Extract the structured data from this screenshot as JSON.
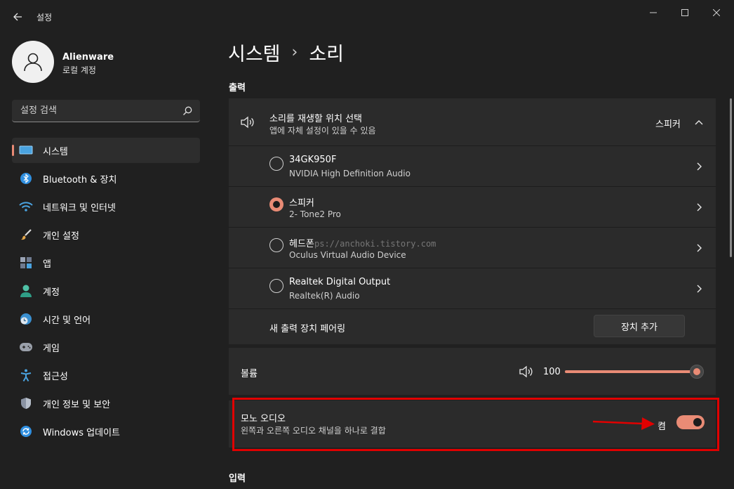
{
  "window": {
    "title": "설정"
  },
  "user": {
    "name": "Alienware",
    "account_type": "로컬 계정"
  },
  "search": {
    "placeholder": "설정 검색"
  },
  "sidebar": {
    "items": [
      {
        "label": "시스템",
        "icon": "system-icon",
        "active": true
      },
      {
        "label": "Bluetooth & 장치",
        "icon": "bluetooth-icon"
      },
      {
        "label": "네트워크 및 인터넷",
        "icon": "wifi-icon"
      },
      {
        "label": "개인 설정",
        "icon": "brush-icon"
      },
      {
        "label": "앱",
        "icon": "apps-icon"
      },
      {
        "label": "계정",
        "icon": "account-icon"
      },
      {
        "label": "시간 및 언어",
        "icon": "clock-globe-icon"
      },
      {
        "label": "게임",
        "icon": "gamepad-icon"
      },
      {
        "label": "접근성",
        "icon": "accessibility-icon"
      },
      {
        "label": "개인 정보 및 보안",
        "icon": "shield-icon"
      },
      {
        "label": "Windows 업데이트",
        "icon": "update-icon"
      }
    ]
  },
  "breadcrumb": {
    "parent": "시스템",
    "separator": "›",
    "current": "소리"
  },
  "output": {
    "section_label": "출력",
    "select": {
      "title": "소리를 재생할 위치 선택",
      "subtitle": "앱에 자체 설정이 있을 수 있음",
      "value": "스피커"
    },
    "devices": [
      {
        "name": "34GK950F",
        "desc": "NVIDIA High Definition Audio",
        "selected": false
      },
      {
        "name": "스피커",
        "desc": "2- Tone2 Pro",
        "selected": true
      },
      {
        "name": "헤드폰",
        "desc": "Oculus Virtual Audio Device",
        "selected": false
      },
      {
        "name": "Realtek Digital Output",
        "desc": "Realtek(R) Audio",
        "selected": false
      }
    ],
    "pair": {
      "label": "새 출력 장치 페어링",
      "button": "장치 추가"
    },
    "volume": {
      "label": "볼륨",
      "value": "100",
      "level": 100
    },
    "mono": {
      "title": "모노 오디오",
      "subtitle": "왼쪽과 오른쪽 오디오 채널을 하나로 결합",
      "state": "켬",
      "on": true
    }
  },
  "input": {
    "section_label": "입력"
  },
  "watermark": "ps://anchoki.tistory.com",
  "colors": {
    "accent": "#e98b75",
    "highlight": "#e10000",
    "background": "#202020",
    "card": "#2b2b2b"
  }
}
